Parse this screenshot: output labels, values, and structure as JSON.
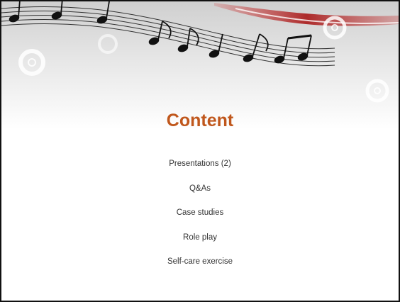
{
  "slide": {
    "title": "Content",
    "items": [
      "Presentations (2)",
      "Q&As",
      "Case studies",
      "Role play",
      "Self-care exercise"
    ]
  },
  "decoration": {
    "banner": "music-staff-notes-banner",
    "icons": [
      "music-note-icon",
      "ring-circle-icon"
    ]
  },
  "colors": {
    "title": "#c0571c",
    "body_text": "#333333",
    "accent_swoosh": "#b01c20",
    "notes": "#111111",
    "border": "#111111"
  }
}
